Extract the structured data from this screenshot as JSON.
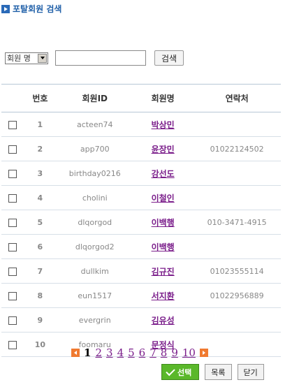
{
  "header": {
    "title": "포탈회원 검색",
    "icon": "arrow-right-icon"
  },
  "search": {
    "field_selected": "회원 명",
    "query": "",
    "button_label": "검색"
  },
  "table": {
    "headers": [
      "번호",
      "회원ID",
      "회원명",
      "연락처"
    ],
    "rows": [
      {
        "num": "1",
        "id": "acteen74",
        "name": "박상민",
        "phone": ""
      },
      {
        "num": "2",
        "id": "app700",
        "name": "윤장민",
        "phone": "01022124502"
      },
      {
        "num": "3",
        "id": "birthday0216",
        "name": "강선도",
        "phone": ""
      },
      {
        "num": "4",
        "id": "cholini",
        "name": "이철인",
        "phone": ""
      },
      {
        "num": "5",
        "id": "dlqorgod",
        "name": "이백행",
        "phone": "010-3471-4915"
      },
      {
        "num": "6",
        "id": "dlqorgod2",
        "name": "이백행",
        "phone": ""
      },
      {
        "num": "7",
        "id": "dullkim",
        "name": "김규진",
        "phone": "01023555114"
      },
      {
        "num": "8",
        "id": "eun1517",
        "name": "서지환",
        "phone": "01022956889"
      },
      {
        "num": "9",
        "id": "evergrin",
        "name": "김유성",
        "phone": ""
      },
      {
        "num": "10",
        "id": "foomaru",
        "name": "문정식",
        "phone": ""
      }
    ]
  },
  "pager": {
    "current": "1",
    "pages": [
      "2",
      "3",
      "4",
      "5",
      "6",
      "7",
      "8",
      "9",
      "10"
    ]
  },
  "actions": {
    "select": "선택",
    "list": "목록",
    "close": "닫기"
  },
  "colors": {
    "accent_blue": "#1f5fa8",
    "link_purple": "#7a1d8a",
    "pager_orange": "#f07a30",
    "select_green": "#5ab82a"
  }
}
